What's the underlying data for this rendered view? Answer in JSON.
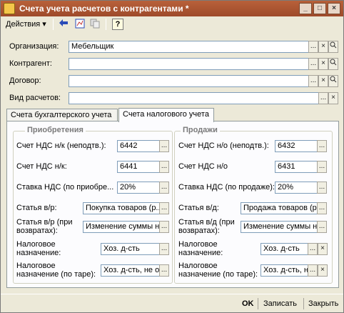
{
  "window": {
    "title": "Счета учета расчетов с контрагентами *",
    "minimize_glyph": "_",
    "maximize_glyph": "□",
    "close_glyph": "×"
  },
  "toolbar": {
    "actions_label": "Действия",
    "actions_arrow": "▾",
    "help_glyph": "?",
    "icons": [
      "go-back-icon",
      "structure-icon",
      "copy-icon",
      "help-icon"
    ]
  },
  "header_fields": {
    "organization": {
      "label": "Организация:",
      "value": "Мебельщик"
    },
    "counterparty": {
      "label": "Контрагент:",
      "value": ""
    },
    "contract": {
      "label": "Договор:",
      "value": ""
    },
    "settlement_type": {
      "label": "Вид расчетов:",
      "value": ""
    }
  },
  "buttons": {
    "select": "...",
    "clear": "×",
    "open": "🔍"
  },
  "tabs": [
    {
      "label": "Счета бухгалтерского учета",
      "active": false
    },
    {
      "label": "Счета налогового учета",
      "active": true
    }
  ],
  "purchases": {
    "title": "Приобретения",
    "vat_account_unconfirmed": {
      "label": "Счет НДС н/к (неподтв.):",
      "value": "6442"
    },
    "vat_account": {
      "label": "Счет НДС н/к:",
      "value": "6441"
    },
    "vat_rate": {
      "label": "Ставка НДС (по приобре...",
      "value": "20%"
    },
    "item": {
      "label": "Статья в/р:",
      "value": "Покупка товаров (р..."
    },
    "item_returns": {
      "label_line1": "Статья в/р (при",
      "label_line2": "возвратах):",
      "value": "Изменение суммы н..."
    },
    "tax_purpose": {
      "label_line1": "Налоговое",
      "label_line2": "назначение:",
      "value": "Хоз. д-сть"
    },
    "tax_purpose_container": {
      "label_line1": "Налоговое",
      "label_line2": "назначение (по таре):",
      "value": "Хоз. д-сть, не о..."
    }
  },
  "sales": {
    "title": "Продажи",
    "vat_account_unconfirmed": {
      "label": "Счет НДС н/о (неподтв.):",
      "value": "6432"
    },
    "vat_account": {
      "label": "Счет НДС н/о",
      "value": "6431"
    },
    "vat_rate": {
      "label": "Ставка НДС (по продаже):",
      "value": "20%"
    },
    "item": {
      "label": "Статья в/д:",
      "value": "Продажа товаров (р..."
    },
    "item_returns": {
      "label_line1": "Статья в/д (при",
      "label_line2": "возвратах):",
      "value": "Изменение суммы н..."
    },
    "tax_purpose": {
      "label_line1": "Налоговое",
      "label_line2": "назначение:",
      "value": "Хоз. д-сть"
    },
    "tax_purpose_container": {
      "label_line1": "Налоговое",
      "label_line2": "назначение (по таре):",
      "value": "Хоз. д-сть, н..."
    }
  },
  "footer": {
    "ok": "OK",
    "save": "Записать",
    "close": "Закрыть"
  },
  "colors": {
    "titlebar": "#a9552f",
    "window_bg": "#ece9d8",
    "input_border": "#7f9db9"
  }
}
